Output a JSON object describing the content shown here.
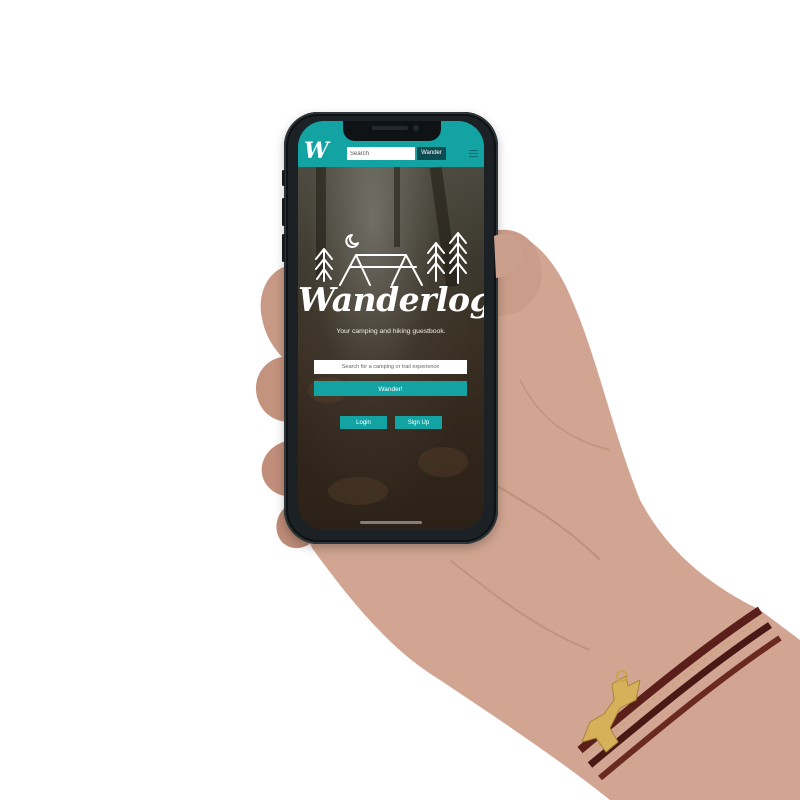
{
  "app": {
    "logo_letter": "W",
    "header": {
      "search_placeholder": "Search",
      "wander_label": "Wander"
    },
    "hero": {
      "brand": "Wanderlog",
      "tagline": "Your camping and hiking guestbook.",
      "search_placeholder": "Search for a camping or trail experience",
      "wander_label": "Wander!",
      "login_label": "Login",
      "signup_label": "Sign Up"
    }
  },
  "colors": {
    "accent": "#14a3a3",
    "accent_dark": "#0d4d52",
    "hero_bg": "#33271c"
  },
  "icons": {
    "logo": "w-script-logo-icon",
    "menu": "hamburger-menu-icon",
    "emblem": "camp-moon-trees-icon"
  }
}
